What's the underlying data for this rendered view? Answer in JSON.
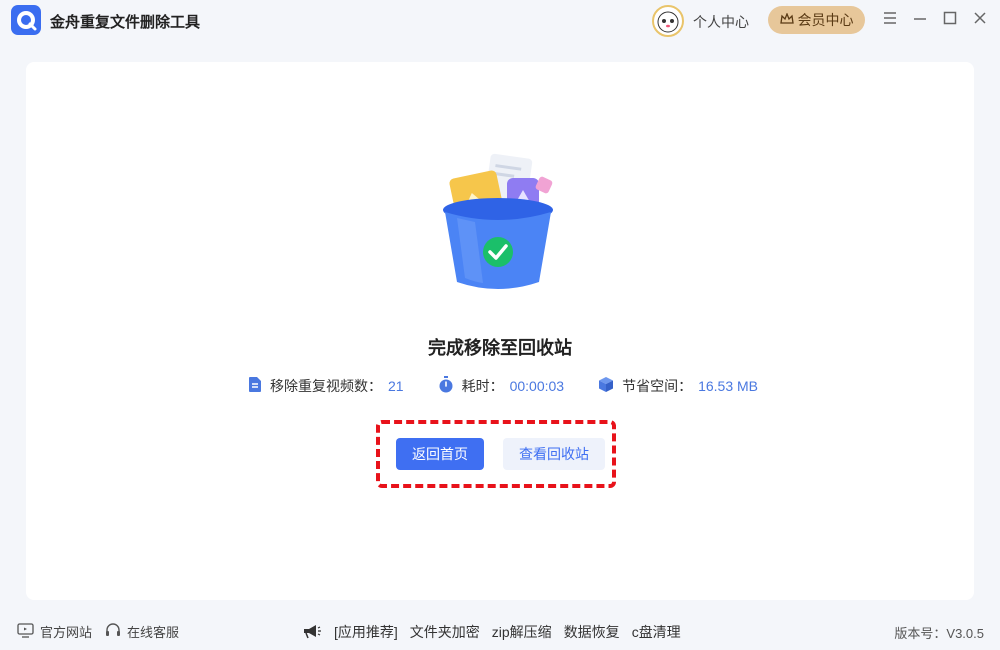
{
  "app": {
    "title": "金舟重复文件删除工具",
    "user_center": "个人中心",
    "vip_label": "会员中心"
  },
  "window_controls": [
    "menu-icon",
    "minimize-icon",
    "maximize-icon",
    "close-icon"
  ],
  "result": {
    "title": "完成移除至回收站",
    "stats": [
      {
        "icon": "document-icon",
        "label": "移除重复视频数：",
        "value": "21"
      },
      {
        "icon": "timer-icon",
        "label": "耗时：",
        "value": "00:00:03"
      },
      {
        "icon": "cube-icon",
        "label": "节省空间：",
        "value": "16.53 MB"
      }
    ],
    "primary_button": "返回首页",
    "secondary_button": "查看回收站"
  },
  "footer": {
    "official_site": "官方网站",
    "online_service": "在线客服",
    "recommend_prefix": "[应用推荐]",
    "recommend_items": [
      "文件夹加密",
      "zip解压缩",
      "数据恢复",
      "c盘清理"
    ],
    "version": "版本号：V3.0.5"
  },
  "colors": {
    "accent": "#3f6ff2",
    "highlight": "#e8121a",
    "vip": "#e7c79a"
  }
}
